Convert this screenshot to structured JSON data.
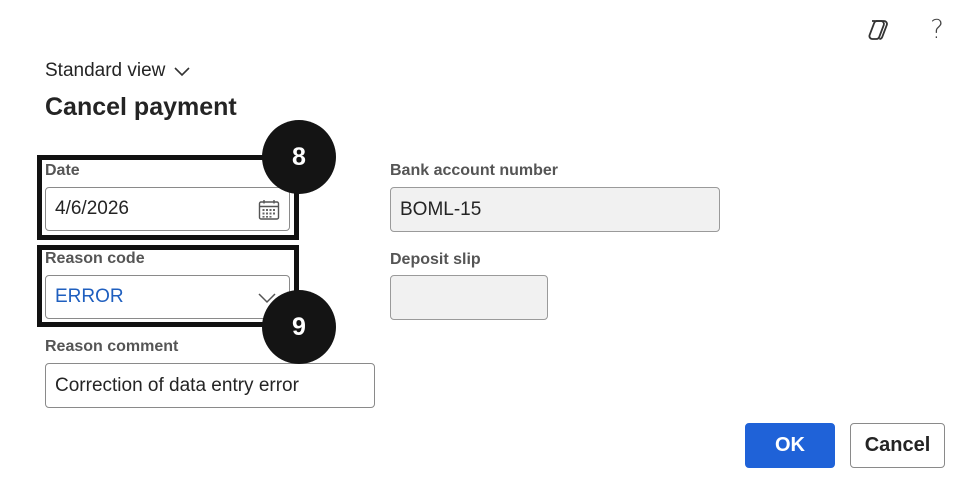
{
  "header": {
    "icons": [
      "copilot-icon",
      "help-icon"
    ],
    "help_glyph": "?"
  },
  "view_selector": {
    "label": "Standard view"
  },
  "dialog": {
    "title": "Cancel payment"
  },
  "fields": {
    "date": {
      "label": "Date",
      "value": "4/6/2026"
    },
    "reason_code": {
      "label": "Reason code",
      "value": "ERROR"
    },
    "reason_comment": {
      "label": "Reason comment",
      "value": "Correction of data entry error"
    },
    "bank_account_number": {
      "label": "Bank account number",
      "value": "BOML-15"
    },
    "deposit_slip": {
      "label": "Deposit slip",
      "value": ""
    }
  },
  "callouts": {
    "first": "8",
    "second": "9"
  },
  "buttons": {
    "ok": "OK",
    "cancel": "Cancel"
  },
  "colors": {
    "primary": "#1f62d8",
    "link_value": "#1f5fbf",
    "callout": "#141414"
  }
}
